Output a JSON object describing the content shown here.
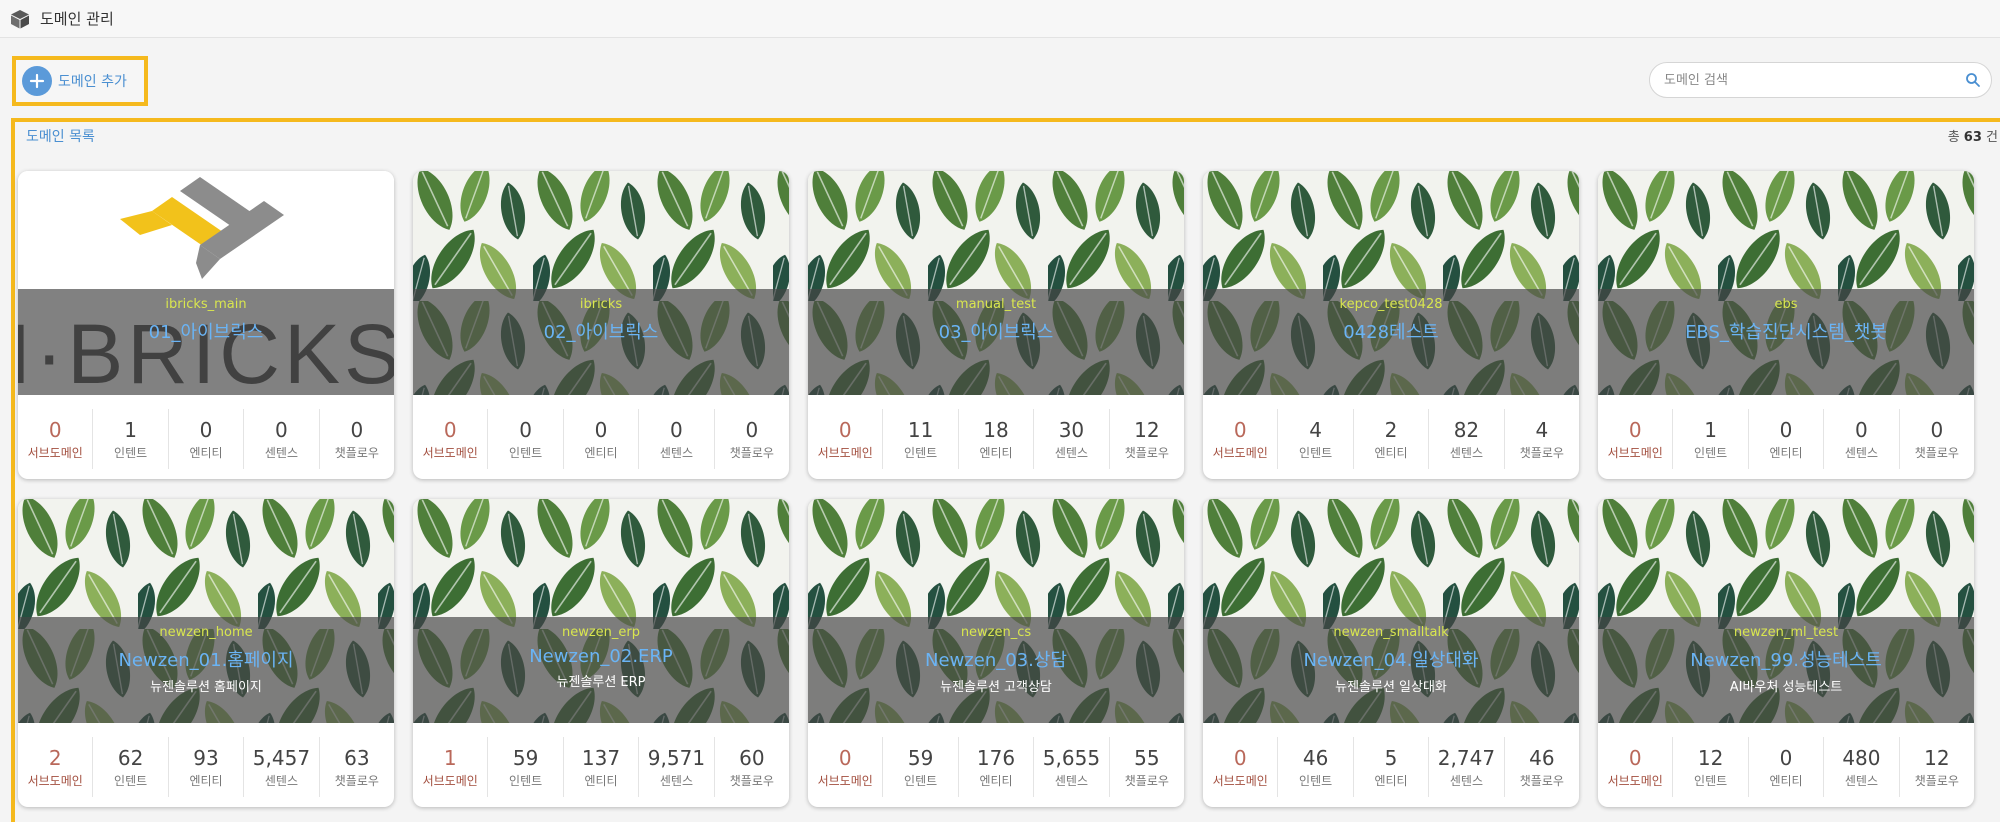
{
  "header": {
    "title": "도메인 관리",
    "icon": "cube-icon"
  },
  "toolbar": {
    "add_label": "도메인 추가"
  },
  "search": {
    "placeholder": "도메인 검색"
  },
  "list": {
    "title": "도메인 목록",
    "total_prefix": "총",
    "total_count": "63",
    "total_suffix": "건"
  },
  "stat_labels": {
    "sub": "서브도메인",
    "intent": "인텐트",
    "entity": "엔티티",
    "sentence": "센텐스",
    "chatflow": "챗플로우"
  },
  "logo_text": "I·BRICKS",
  "colors": {
    "accent_yellow": "#f5b91d",
    "link_blue": "#4a8fd1",
    "code_yellow": "#d9e64f",
    "name_blue": "#6ab4f5",
    "subdomain_red": "#b9685a"
  },
  "cards": [
    {
      "code": "ibricks_main",
      "name": "01_아이브릭스",
      "desc": "",
      "image": "ibricks-logo",
      "stats": [
        "0",
        "1",
        "0",
        "0",
        "0"
      ]
    },
    {
      "code": "ibricks",
      "name": "02_아이브릭스",
      "desc": "",
      "image": "leaves",
      "stats": [
        "0",
        "0",
        "0",
        "0",
        "0"
      ]
    },
    {
      "code": "manual_test",
      "name": "03_아이브릭스",
      "desc": "",
      "image": "leaves",
      "stats": [
        "0",
        "11",
        "18",
        "30",
        "12"
      ]
    },
    {
      "code": "kepco_test0428",
      "name": "0428테스트",
      "desc": "",
      "image": "leaves",
      "stats": [
        "0",
        "4",
        "2",
        "82",
        "4"
      ]
    },
    {
      "code": "ebs",
      "name": "EBS_학습진단시스템_챗봇",
      "desc": "",
      "image": "leaves",
      "stats": [
        "0",
        "1",
        "0",
        "0",
        "0"
      ]
    },
    {
      "code": "newzen_home",
      "name": "Newzen_01.홈페이지",
      "desc": "뉴젠솔루션 홈페이지",
      "image": "leaves",
      "stats": [
        "2",
        "62",
        "93",
        "5,457",
        "63"
      ]
    },
    {
      "code": "newzen_erp",
      "name": "Newzen_02.ERP",
      "desc": "뉴젠솔루션 ERP",
      "image": "leaves",
      "stats": [
        "1",
        "59",
        "137",
        "9,571",
        "60"
      ]
    },
    {
      "code": "newzen_cs",
      "name": "Newzen_03.상담",
      "desc": "뉴젠솔루션 고객상담",
      "image": "leaves",
      "stats": [
        "0",
        "59",
        "176",
        "5,655",
        "55"
      ]
    },
    {
      "code": "newzen_smalltalk",
      "name": "Newzen_04.일상대화",
      "desc": "뉴젠솔루션 일상대화",
      "image": "leaves",
      "stats": [
        "0",
        "46",
        "5",
        "2,747",
        "46"
      ]
    },
    {
      "code": "newzen_ml_test",
      "name": "Newzen_99.성능테스트",
      "desc": "AI바우처 성능테스트",
      "image": "leaves",
      "stats": [
        "0",
        "12",
        "0",
        "480",
        "12"
      ]
    }
  ]
}
